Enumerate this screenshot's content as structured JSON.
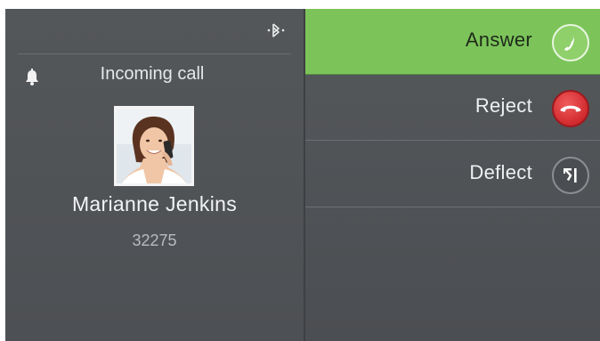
{
  "status": {
    "bluetooth_icon": "bluetooth-icon",
    "notification_icon": "bell-icon",
    "title": "Incoming call"
  },
  "caller": {
    "name": "Marianne Jenkins",
    "number": "32275",
    "avatar": "caller-photo"
  },
  "actions": [
    {
      "label": "Answer",
      "icon": "phone-answer-icon",
      "color": "#7cc45a"
    },
    {
      "label": "Reject",
      "icon": "phone-hangup-icon",
      "color": "#d9252b"
    },
    {
      "label": "Deflect",
      "icon": "deflect-icon",
      "color": "#4a4d51"
    }
  ],
  "colors": {
    "accent_green": "#7cc45a",
    "reject_red": "#d9252b",
    "panel_gray": "#4f5256"
  }
}
